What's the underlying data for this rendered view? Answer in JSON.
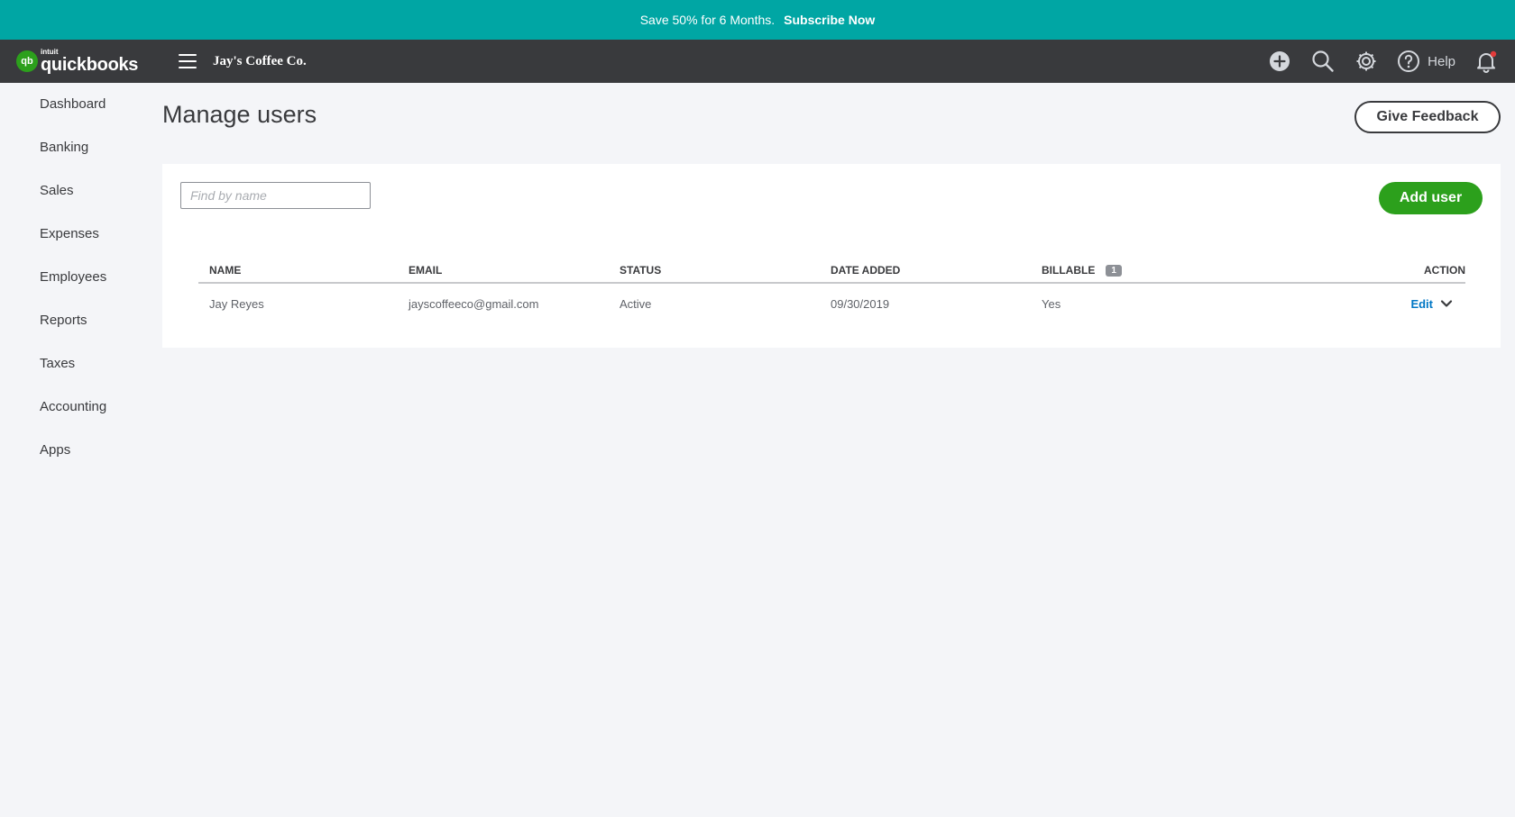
{
  "promo": {
    "text": "Save 50% for 6 Months.",
    "cta": "Subscribe Now"
  },
  "header": {
    "logo_intuit": "intuit",
    "logo_brand": "quickbooks",
    "logo_badge": "qb",
    "company": "Jay's Coffee Co.",
    "help_label": "Help",
    "icons": [
      "plus-circle-icon",
      "search-icon",
      "gear-icon",
      "help-icon",
      "bell-icon"
    ]
  },
  "sidebar": {
    "items": [
      {
        "label": "Dashboard"
      },
      {
        "label": "Banking"
      },
      {
        "label": "Sales"
      },
      {
        "label": "Expenses"
      },
      {
        "label": "Employees"
      },
      {
        "label": "Reports"
      },
      {
        "label": "Taxes"
      },
      {
        "label": "Accounting"
      },
      {
        "label": "Apps"
      }
    ]
  },
  "main": {
    "title": "Manage users",
    "feedback_label": "Give Feedback",
    "search_placeholder": "Find by name",
    "add_user_label": "Add user",
    "table": {
      "headers": {
        "name": "NAME",
        "email": "EMAIL",
        "status": "STATUS",
        "date_added": "DATE ADDED",
        "billable": "BILLABLE",
        "billable_count": "1",
        "action": "ACTION"
      },
      "rows": [
        {
          "name": "Jay Reyes",
          "email": "jayscoffeeco@gmail.com",
          "status": "Active",
          "date_added": "09/30/2019",
          "billable": "Yes",
          "action": "Edit"
        }
      ]
    }
  },
  "colors": {
    "promo": "#00a6a4",
    "topbar": "#393a3d",
    "accent_green": "#2ca01c",
    "link_blue": "#0077c5",
    "notification_dot": "#e33b3b"
  }
}
